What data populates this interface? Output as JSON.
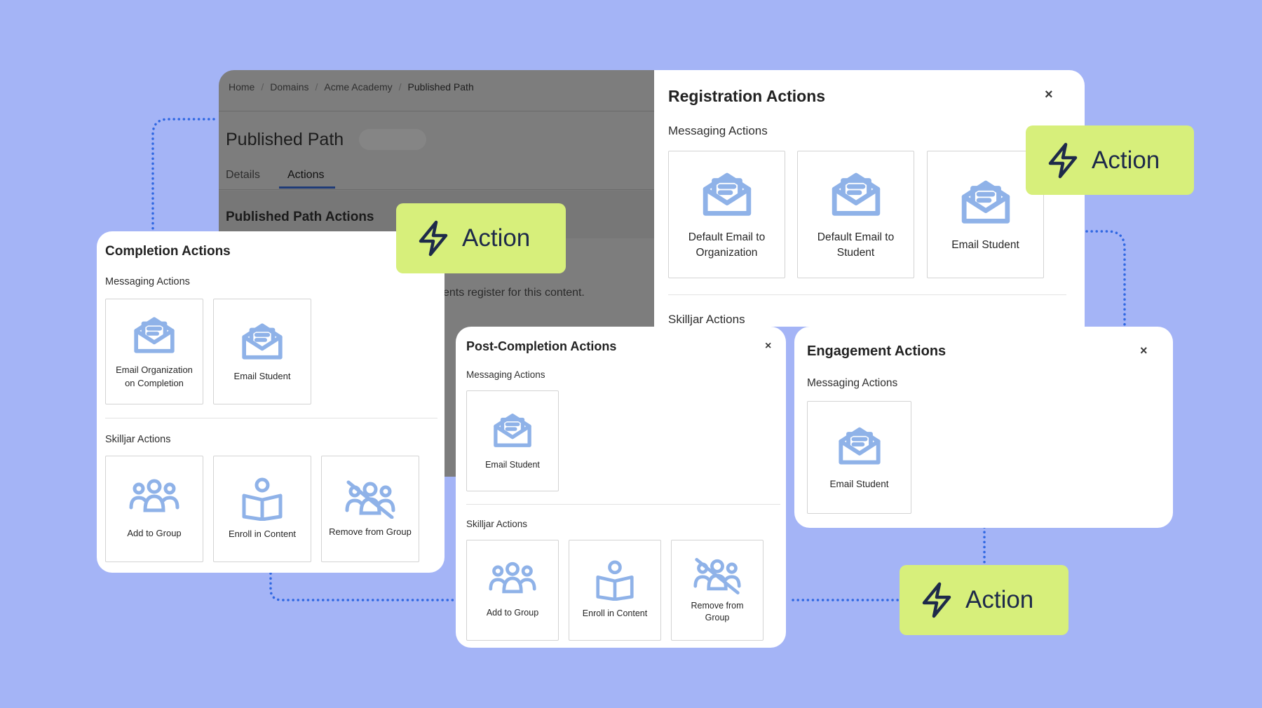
{
  "colors": {
    "background": "#a4b4f6",
    "badge": "#d7ef7b",
    "icon": "#8fb2e8",
    "connector": "#2f67e2"
  },
  "app": {
    "breadcrumb": [
      "Home",
      "Domains",
      "Acme Academy",
      "Published Path"
    ],
    "title": "Published Path",
    "tabs": [
      "Details",
      "Actions"
    ],
    "active_tab": "Actions",
    "section_title": "Published Path Actions",
    "partial_text": "ents register for this content."
  },
  "registration": {
    "title": "Registration Actions",
    "close": "×",
    "messaging_label": "Messaging Actions",
    "skilljar_label": "Skilljar Actions",
    "tiles": [
      {
        "label": "Default Email to Organization",
        "icon": "envelope-icon"
      },
      {
        "label": "Default Email to Student",
        "icon": "envelope-icon"
      },
      {
        "label": "Email Student",
        "icon": "envelope-icon"
      }
    ]
  },
  "completion": {
    "title": "Completion Actions",
    "messaging_label": "Messaging Actions",
    "skilljar_label": "Skilljar Actions",
    "messaging_tiles": [
      {
        "label": "Email Organization on Completion",
        "icon": "envelope-icon"
      },
      {
        "label": "Email Student",
        "icon": "envelope-icon"
      }
    ],
    "skilljar_tiles": [
      {
        "label": "Add to Group",
        "icon": "group-icon"
      },
      {
        "label": "Enroll in Content",
        "icon": "enroll-icon"
      },
      {
        "label": "Remove from Group",
        "icon": "remove-group-icon"
      }
    ]
  },
  "post_completion": {
    "title": "Post-Completion Actions",
    "close": "×",
    "messaging_label": "Messaging Actions",
    "skilljar_label": "Skilljar Actions",
    "messaging_tiles": [
      {
        "label": "Email Student",
        "icon": "envelope-icon"
      }
    ],
    "skilljar_tiles": [
      {
        "label": "Add to Group",
        "icon": "group-icon"
      },
      {
        "label": "Enroll in Content",
        "icon": "enroll-icon"
      },
      {
        "label": "Remove from Group",
        "icon": "remove-group-icon"
      }
    ]
  },
  "engagement": {
    "title": "Engagement Actions",
    "close": "×",
    "messaging_label": "Messaging Actions",
    "tiles": [
      {
        "label": "Email Student",
        "icon": "envelope-icon"
      }
    ]
  },
  "badges": [
    {
      "label": "Action",
      "icon": "lightning-icon"
    },
    {
      "label": "Action",
      "icon": "lightning-icon"
    },
    {
      "label": "Action",
      "icon": "lightning-icon"
    }
  ]
}
